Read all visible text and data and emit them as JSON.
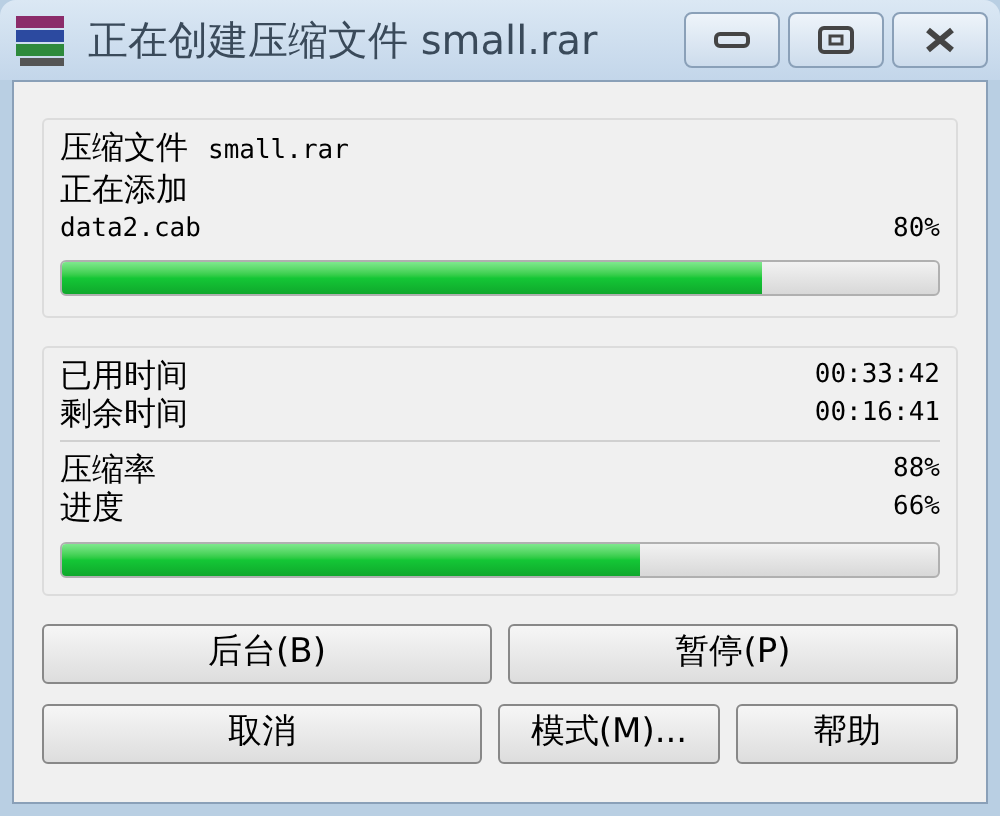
{
  "window": {
    "title": "正在创建压缩文件 small.rar"
  },
  "file_panel": {
    "archive_label": "压缩文件",
    "archive_name": "small.rar",
    "action": "正在添加",
    "current_file": "data2.cab",
    "percent": "80%",
    "level": 0.8
  },
  "time_panel": [
    {
      "label": "已用时间",
      "value": "00:33:42"
    },
    {
      "label": "剩余时间",
      "value": "00:16:41"
    }
  ],
  "stats_panel": [
    {
      "label": "压缩率",
      "value": "88%"
    },
    {
      "label": "进度",
      "value": "66%"
    }
  ],
  "total_progress": {
    "level": 0.66
  },
  "buttons": [
    [
      {
        "label": "后台(B)"
      },
      {
        "label": "暂停(P)"
      }
    ],
    [
      {
        "label": "取消"
      },
      {
        "label": "模式(M)..."
      },
      {
        "label": "帮助"
      }
    ]
  ]
}
